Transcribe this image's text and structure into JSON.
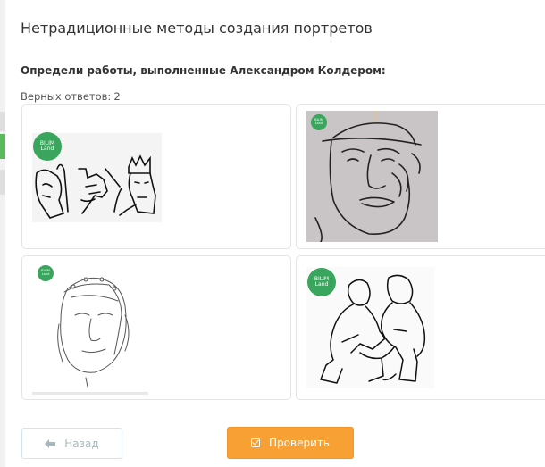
{
  "page": {
    "title": "Нетрадиционные методы создания портретов",
    "question": "Определи работы, выполненные Александром Колдером:",
    "answers_label": "Верных ответов:",
    "answers_count": "2"
  },
  "logo": {
    "line1": "BILIM",
    "line2": "Land"
  },
  "options": [
    {
      "icon": "line-drawing-faces-image"
    },
    {
      "icon": "wire-sculpture-face-image"
    },
    {
      "icon": "sketch-portrait-image"
    },
    {
      "icon": "line-drawing-children-image"
    }
  ],
  "buttons": {
    "back": "Назад",
    "check": "Проверить"
  },
  "colors": {
    "accent_green": "#5bb85d",
    "check_button": "#f7a134",
    "logo_green": "#3aa55d"
  }
}
